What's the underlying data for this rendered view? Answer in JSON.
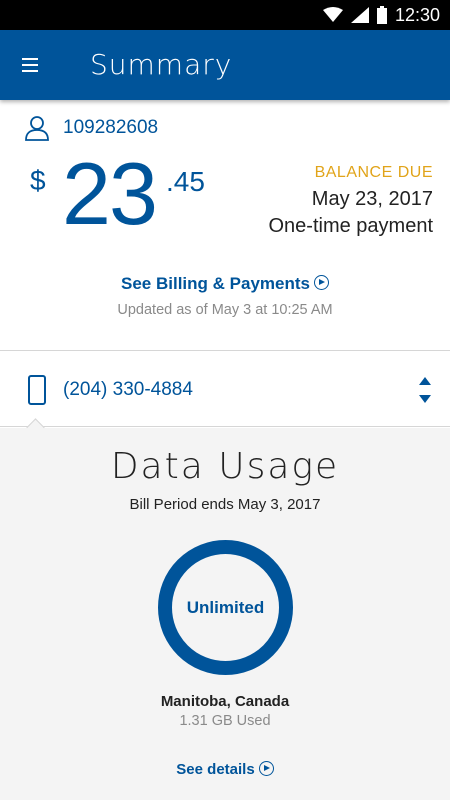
{
  "status_bar": {
    "time": "12:30"
  },
  "app_bar": {
    "title": "Summary"
  },
  "account": {
    "number": "109282608"
  },
  "balance": {
    "currency": "$",
    "dollars": "23",
    "cents": ".45",
    "label": "BALANCE DUE",
    "due_date": "May 23, 2017",
    "payment_type": "One-time payment"
  },
  "billing": {
    "link_label": "See Billing & Payments",
    "updated_text": "Updated as of May 3 at 10:25 AM"
  },
  "line": {
    "phone_number": "(204) 330-4884"
  },
  "usage": {
    "title": "Data Usage",
    "bill_period": "Bill Period ends May 3, 2017",
    "plan_label": "Unlimited",
    "region": "Manitoba, Canada",
    "used": "1.31 GB Used",
    "details_link": "See details"
  },
  "colors": {
    "brand_blue": "#00549a",
    "accent_gold": "#e1a41a",
    "status_bar": "#000000",
    "section_bg": "#f4f4f4"
  },
  "icons": [
    "wifi-icon",
    "signal-icon",
    "battery-icon",
    "menu-icon",
    "user-icon",
    "phone-icon",
    "sort-icon",
    "chevron-circle-icon"
  ]
}
